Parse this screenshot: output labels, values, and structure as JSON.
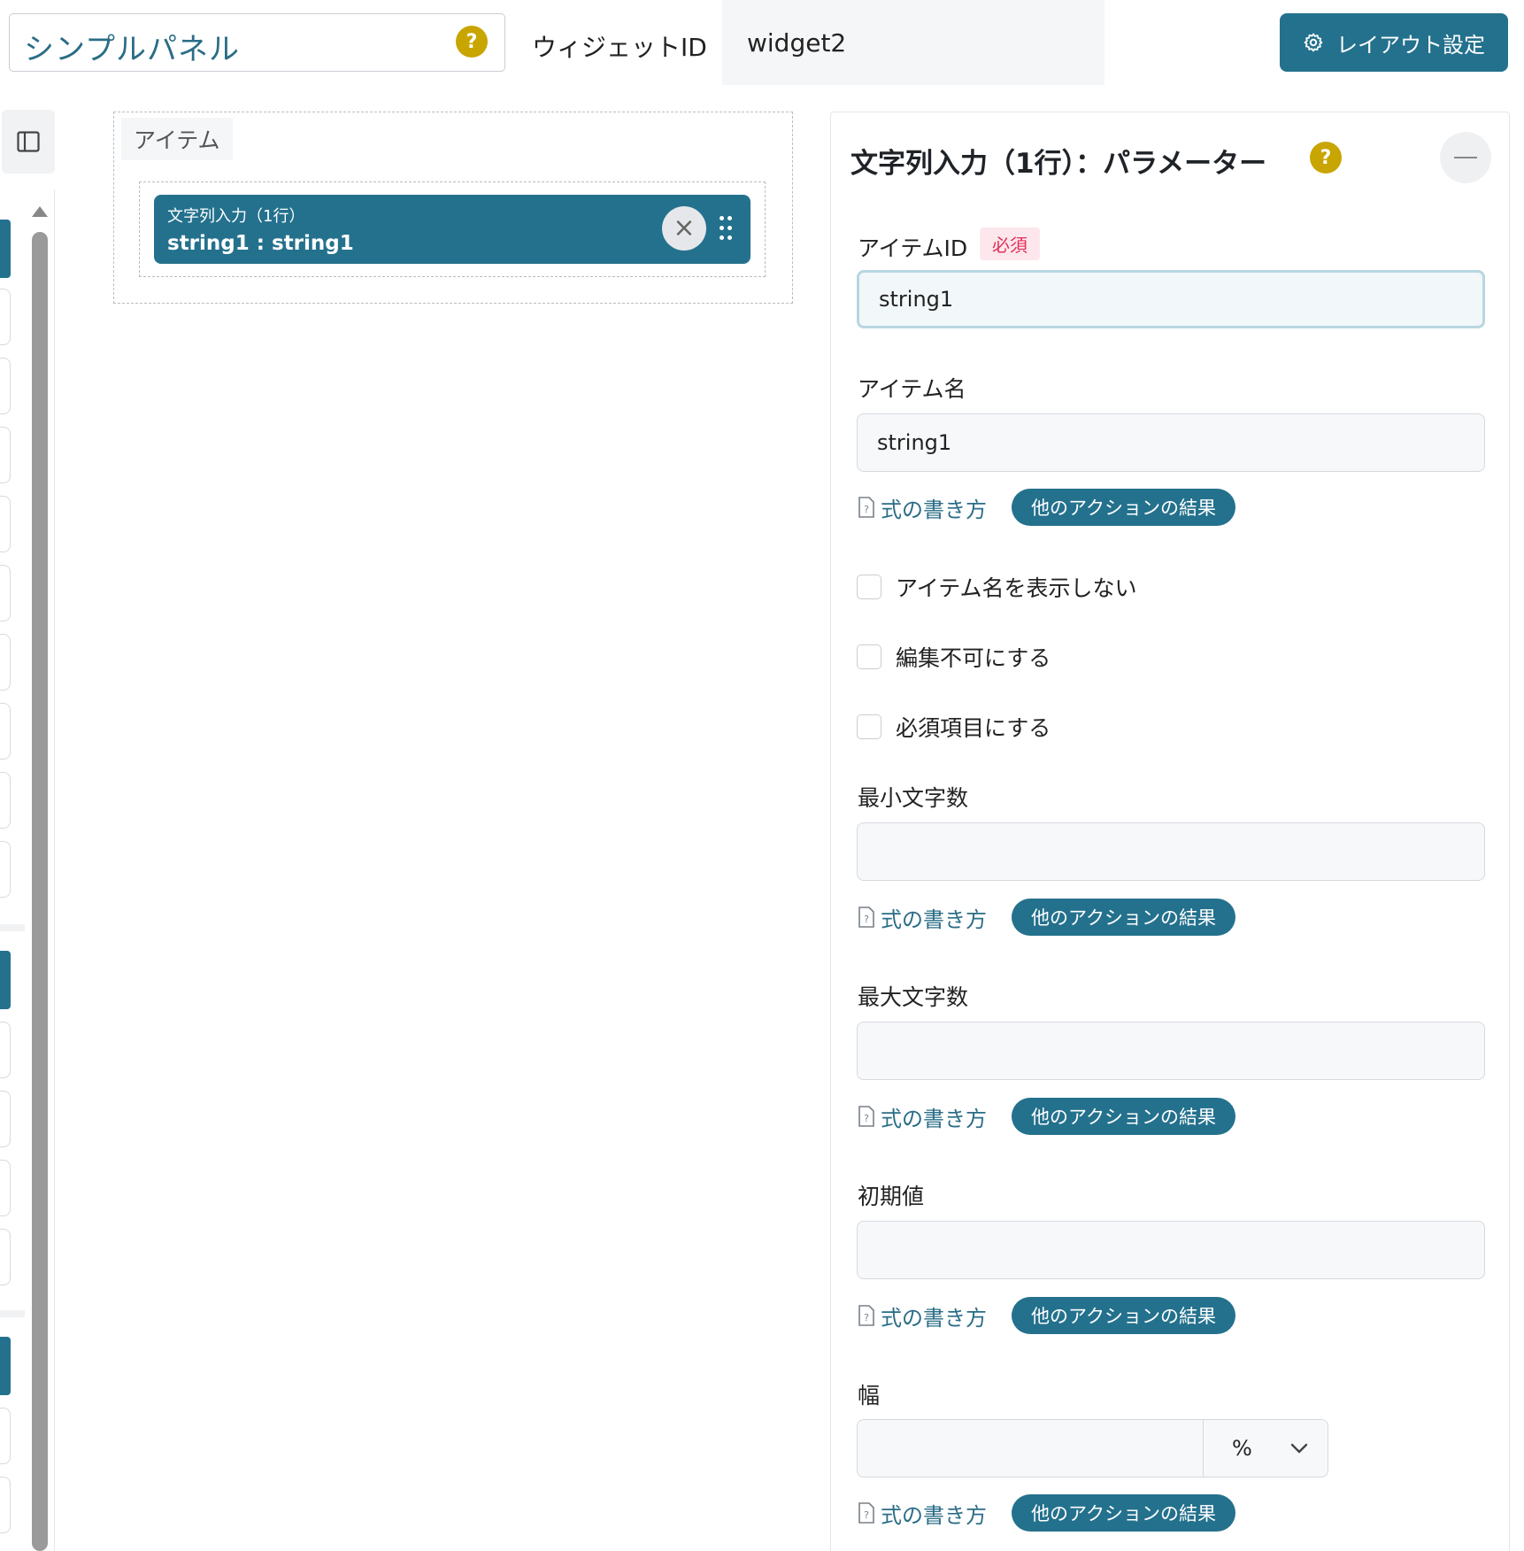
{
  "header": {
    "panel_title": "シンプルパネル",
    "help_symbol": "?",
    "widget_id_label": "ウィジェットID",
    "widget_id_value": "widget2",
    "layout_button_label": "レイアウト設定"
  },
  "canvas": {
    "items_label": "アイテム",
    "item": {
      "type": "文字列入力（1行）",
      "name": "string1 : string1",
      "close_symbol": "×"
    }
  },
  "params": {
    "title": "文字列入力（1行）：パラメーター",
    "help_symbol": "?",
    "item_id": {
      "label": "アイテムID",
      "required_badge": "必須",
      "value": "string1"
    },
    "item_name": {
      "label": "アイテム名",
      "value": "string1"
    },
    "expr_link_label": "式の書き方",
    "other_action_label": "他のアクションの結果",
    "checkboxes": [
      {
        "label": "アイテム名を表示しない",
        "checked": false
      },
      {
        "label": "編集不可にする",
        "checked": false
      },
      {
        "label": "必須項目にする",
        "checked": false
      }
    ],
    "min_length": {
      "label": "最小文字数",
      "value": ""
    },
    "max_length": {
      "label": "最大文字数",
      "value": ""
    },
    "initial_value": {
      "label": "初期値",
      "value": ""
    },
    "width": {
      "label": "幅",
      "value": "",
      "unit": "%"
    }
  },
  "icons": {
    "help": "question-circle-icon",
    "layout": "gear-icon",
    "sidebar_toggle": "sidebar-panel-icon",
    "close": "close-icon",
    "drag": "drag-handle-icon",
    "collapse": "minus-icon",
    "doc": "document-help-icon",
    "dropdown": "chevron-down-icon"
  },
  "colors": {
    "accent": "#24718d",
    "help": "#c8a500",
    "required_bg": "#fde7ec",
    "required_text": "#e0305a"
  }
}
